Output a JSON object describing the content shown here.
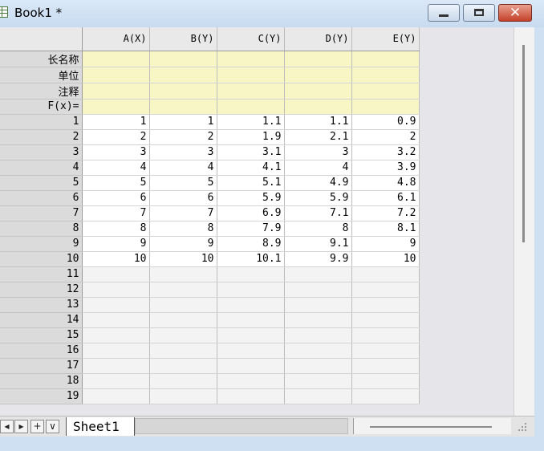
{
  "window": {
    "title": "Book1 *",
    "minimize_label": "",
    "maximize_label": "",
    "close_label": "✕"
  },
  "columns": [
    {
      "label": "A(X)"
    },
    {
      "label": "B(Y)"
    },
    {
      "label": "C(Y)"
    },
    {
      "label": "D(Y)"
    },
    {
      "label": "E(Y)"
    }
  ],
  "meta_rows": [
    {
      "label": "长名称"
    },
    {
      "label": "单位"
    },
    {
      "label": "注释"
    },
    {
      "label": "F(x)="
    }
  ],
  "rows": [
    {
      "n": "1",
      "cells": [
        "1",
        "1",
        "1.1",
        "1.1",
        "0.9"
      ]
    },
    {
      "n": "2",
      "cells": [
        "2",
        "2",
        "1.9",
        "2.1",
        "2"
      ]
    },
    {
      "n": "3",
      "cells": [
        "3",
        "3",
        "3.1",
        "3",
        "3.2"
      ]
    },
    {
      "n": "4",
      "cells": [
        "4",
        "4",
        "4.1",
        "4",
        "3.9"
      ]
    },
    {
      "n": "5",
      "cells": [
        "5",
        "5",
        "5.1",
        "4.9",
        "4.8"
      ]
    },
    {
      "n": "6",
      "cells": [
        "6",
        "6",
        "5.9",
        "5.9",
        "6.1"
      ]
    },
    {
      "n": "7",
      "cells": [
        "7",
        "7",
        "6.9",
        "7.1",
        "7.2"
      ]
    },
    {
      "n": "8",
      "cells": [
        "8",
        "8",
        "7.9",
        "8",
        "8.1"
      ]
    },
    {
      "n": "9",
      "cells": [
        "9",
        "9",
        "8.9",
        "9.1",
        "9"
      ]
    },
    {
      "n": "10",
      "cells": [
        "10",
        "10",
        "10.1",
        "9.9",
        "10"
      ]
    },
    {
      "n": "11",
      "cells": [
        "",
        "",
        "",
        "",
        ""
      ]
    },
    {
      "n": "12",
      "cells": [
        "",
        "",
        "",
        "",
        ""
      ]
    },
    {
      "n": "13",
      "cells": [
        "",
        "",
        "",
        "",
        ""
      ]
    },
    {
      "n": "14",
      "cells": [
        "",
        "",
        "",
        "",
        ""
      ]
    },
    {
      "n": "15",
      "cells": [
        "",
        "",
        "",
        "",
        ""
      ]
    },
    {
      "n": "16",
      "cells": [
        "",
        "",
        "",
        "",
        ""
      ]
    },
    {
      "n": "17",
      "cells": [
        "",
        "",
        "",
        "",
        ""
      ]
    },
    {
      "n": "18",
      "cells": [
        "",
        "",
        "",
        "",
        ""
      ]
    },
    {
      "n": "19",
      "cells": [
        "",
        "",
        "",
        "",
        ""
      ]
    }
  ],
  "bottom": {
    "nav": [
      "◂",
      "▸",
      "+",
      "∨"
    ],
    "tab_label": "Sheet1"
  }
}
